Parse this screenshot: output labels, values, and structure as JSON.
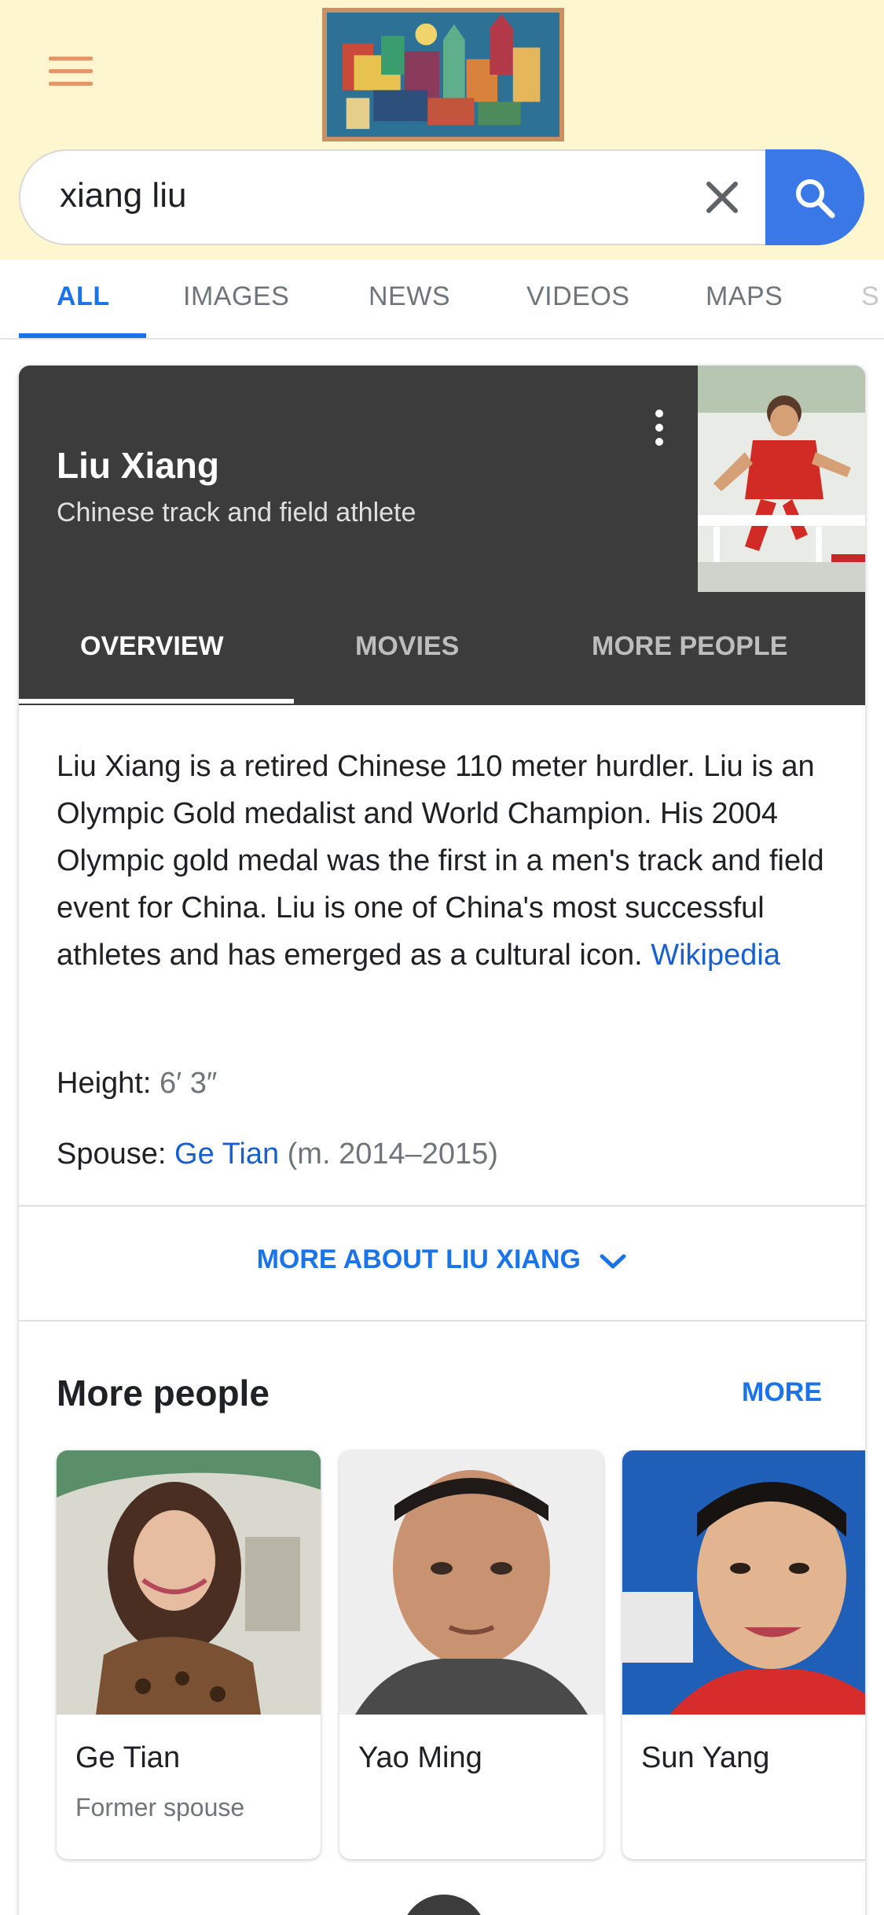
{
  "search": {
    "query": "xiang liu"
  },
  "tabs": [
    {
      "label": "ALL",
      "active": true
    },
    {
      "label": "IMAGES",
      "active": false
    },
    {
      "label": "NEWS",
      "active": false
    },
    {
      "label": "VIDEOS",
      "active": false
    },
    {
      "label": "MAPS",
      "active": false
    },
    {
      "label": "S",
      "active": false
    }
  ],
  "knowledge_panel": {
    "title": "Liu Xiang",
    "subtitle": "Chinese track and field athlete",
    "tabs": [
      {
        "label": "OVERVIEW",
        "active": true
      },
      {
        "label": "MOVIES",
        "active": false
      },
      {
        "label": "MORE PEOPLE",
        "active": false
      }
    ],
    "description": "Liu Xiang is a retired Chinese 110 meter hurdler. Liu is an Olympic Gold medalist and World Champion. His 2004 Olympic gold medal was the first in a men's track and field event for China. Liu is one of China's most successful athletes and has emerged as a cultural icon.",
    "source_link": "Wikipedia",
    "facts": {
      "height_label": "Height:",
      "height_value": "6′ 3″",
      "spouse_label": "Spouse:",
      "spouse_link": "Ge Tian",
      "spouse_note": "(m. 2014–2015)"
    },
    "more_about": "MORE ABOUT LIU XIANG"
  },
  "more_people": {
    "title": "More people",
    "more_label": "MORE",
    "people": [
      {
        "name": "Ge Tian",
        "role": "Former spouse"
      },
      {
        "name": "Yao Ming",
        "role": ""
      },
      {
        "name": "Sun Yang",
        "role": ""
      }
    ]
  },
  "colors": {
    "accent": "#1a73e8",
    "header_bg": "#fdf6cf",
    "panel_dark": "#3c3c3c",
    "search_button": "#3b78e7"
  },
  "icons": {
    "menu": "hamburger-icon",
    "clear": "close-icon",
    "search": "search-icon",
    "overflow": "more-vert-icon",
    "expand": "chevron-down-icon"
  }
}
